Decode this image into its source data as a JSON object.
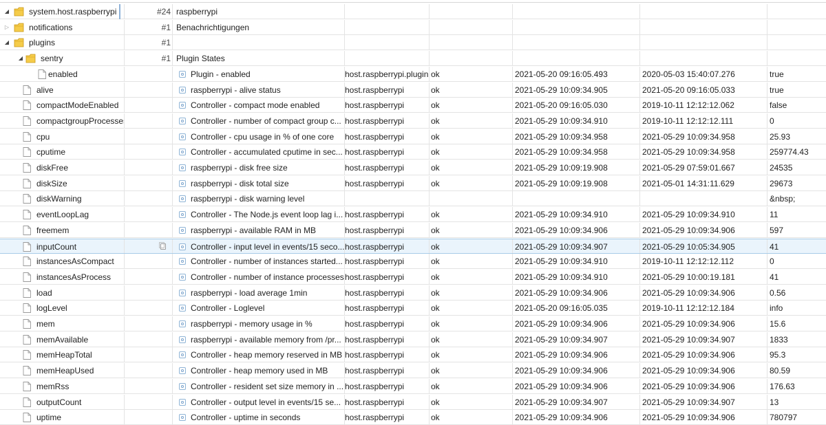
{
  "rows": [
    {
      "kind": "folder",
      "level": 0,
      "open": true,
      "name": "system.host.raspberrypi",
      "count": "#24",
      "desc": "raspberrypi",
      "boxed": true
    },
    {
      "kind": "folder",
      "level": 1,
      "open": false,
      "name": "notifications",
      "count": "#1",
      "desc": "Benachrichtigungen"
    },
    {
      "kind": "folder",
      "level": 1,
      "open": true,
      "name": "plugins",
      "count": "#1",
      "desc": ""
    },
    {
      "kind": "folder",
      "level": 2,
      "open": true,
      "name": "sentry",
      "count": "#1",
      "desc": "Plugin States"
    },
    {
      "kind": "state",
      "level": 3,
      "name": "enabled",
      "desc": "Plugin - enabled",
      "room": "host.raspberrypi.plugin",
      "ack": "ok",
      "ts": "2021-05-20 09:16:05.493",
      "lc": "2020-05-03 15:40:07.276",
      "val": "true"
    },
    {
      "kind": "state",
      "level": 1,
      "name": "alive",
      "desc": "raspberrypi - alive status",
      "room": "host.raspberrypi",
      "ack": "ok",
      "ts": "2021-05-29 10:09:34.905",
      "lc": "2021-05-20 09:16:05.033",
      "val": "true"
    },
    {
      "kind": "state",
      "level": 1,
      "name": "compactModeEnabled",
      "desc": "Controller - compact mode enabled",
      "room": "host.raspberrypi",
      "ack": "ok",
      "ts": "2021-05-20 09:16:05.030",
      "lc": "2019-10-11 12:12:12.062",
      "val": "false"
    },
    {
      "kind": "state",
      "level": 1,
      "name": "compactgroupProcesses",
      "desc": "Controller - number of compact group c...",
      "room": "host.raspberrypi",
      "ack": "ok",
      "ts": "2021-05-29 10:09:34.910",
      "lc": "2019-10-11 12:12:12.111",
      "val": "0"
    },
    {
      "kind": "state",
      "level": 1,
      "name": "cpu",
      "desc": "Controller - cpu usage in % of one core",
      "room": "host.raspberrypi",
      "ack": "ok",
      "ts": "2021-05-29 10:09:34.958",
      "lc": "2021-05-29 10:09:34.958",
      "val": "25.93"
    },
    {
      "kind": "state",
      "level": 1,
      "name": "cputime",
      "desc": "Controller - accumulated cputime in sec...",
      "room": "host.raspberrypi",
      "ack": "ok",
      "ts": "2021-05-29 10:09:34.958",
      "lc": "2021-05-29 10:09:34.958",
      "val": "259774.43"
    },
    {
      "kind": "state",
      "level": 1,
      "name": "diskFree",
      "desc": "raspberrypi - disk free size",
      "room": "host.raspberrypi",
      "ack": "ok",
      "ts": "2021-05-29 10:09:19.908",
      "lc": "2021-05-29 07:59:01.667",
      "val": "24535"
    },
    {
      "kind": "state",
      "level": 1,
      "name": "diskSize",
      "desc": "raspberrypi - disk total size",
      "room": "host.raspberrypi",
      "ack": "ok",
      "ts": "2021-05-29 10:09:19.908",
      "lc": "2021-05-01 14:31:11.629",
      "val": "29673"
    },
    {
      "kind": "state",
      "level": 1,
      "name": "diskWarning",
      "desc": "raspberrypi - disk warning level",
      "room": "",
      "ack": "",
      "ts": "",
      "lc": "",
      "val": "&nbsp;"
    },
    {
      "kind": "state",
      "level": 1,
      "name": "eventLoopLag",
      "desc": "Controller - The Node.js event loop lag i...",
      "room": "host.raspberrypi",
      "ack": "ok",
      "ts": "2021-05-29 10:09:34.910",
      "lc": "2021-05-29 10:09:34.910",
      "val": "11"
    },
    {
      "kind": "state",
      "level": 1,
      "name": "freemem",
      "desc": "raspberrypi - available RAM in MB",
      "room": "host.raspberrypi",
      "ack": "ok",
      "ts": "2021-05-29 10:09:34.906",
      "lc": "2021-05-29 10:09:34.906",
      "val": "597"
    },
    {
      "kind": "state",
      "level": 1,
      "name": "inputCount",
      "desc": "Controller - input level in events/15 seco...",
      "room": "host.raspberrypi",
      "ack": "ok",
      "ts": "2021-05-29 10:09:34.907",
      "lc": "2021-05-29 10:05:34.905",
      "val": "41",
      "selected": true
    },
    {
      "kind": "state",
      "level": 1,
      "name": "instancesAsCompact",
      "desc": "Controller - number of instances started...",
      "room": "host.raspberrypi",
      "ack": "ok",
      "ts": "2021-05-29 10:09:34.910",
      "lc": "2019-10-11 12:12:12.112",
      "val": "0"
    },
    {
      "kind": "state",
      "level": 1,
      "name": "instancesAsProcess",
      "desc": "Controller - number of instance processes",
      "room": "host.raspberrypi",
      "ack": "ok",
      "ts": "2021-05-29 10:09:34.910",
      "lc": "2021-05-29 10:00:19.181",
      "val": "41"
    },
    {
      "kind": "state",
      "level": 1,
      "name": "load",
      "desc": "raspberrypi - load average 1min",
      "room": "host.raspberrypi",
      "ack": "ok",
      "ts": "2021-05-29 10:09:34.906",
      "lc": "2021-05-29 10:09:34.906",
      "val": "0.56"
    },
    {
      "kind": "state",
      "level": 1,
      "name": "logLevel",
      "desc": "Controller - Loglevel",
      "room": "host.raspberrypi",
      "ack": "ok",
      "ts": "2021-05-20 09:16:05.035",
      "lc": "2019-10-11 12:12:12.184",
      "val": "info"
    },
    {
      "kind": "state",
      "level": 1,
      "name": "mem",
      "desc": "raspberrypi - memory usage in %",
      "room": "host.raspberrypi",
      "ack": "ok",
      "ts": "2021-05-29 10:09:34.906",
      "lc": "2021-05-29 10:09:34.906",
      "val": "15.6"
    },
    {
      "kind": "state",
      "level": 1,
      "name": "memAvailable",
      "desc": "raspberrypi - available memory from /pr...",
      "room": "host.raspberrypi",
      "ack": "ok",
      "ts": "2021-05-29 10:09:34.907",
      "lc": "2021-05-29 10:09:34.907",
      "val": "1833"
    },
    {
      "kind": "state",
      "level": 1,
      "name": "memHeapTotal",
      "desc": "Controller - heap memory reserved in MB",
      "room": "host.raspberrypi",
      "ack": "ok",
      "ts": "2021-05-29 10:09:34.906",
      "lc": "2021-05-29 10:09:34.906",
      "val": "95.3"
    },
    {
      "kind": "state",
      "level": 1,
      "name": "memHeapUsed",
      "desc": "Controller - heap memory used in MB",
      "room": "host.raspberrypi",
      "ack": "ok",
      "ts": "2021-05-29 10:09:34.906",
      "lc": "2021-05-29 10:09:34.906",
      "val": "80.59"
    },
    {
      "kind": "state",
      "level": 1,
      "name": "memRss",
      "desc": "Controller - resident set size memory in ...",
      "room": "host.raspberrypi",
      "ack": "ok",
      "ts": "2021-05-29 10:09:34.906",
      "lc": "2021-05-29 10:09:34.906",
      "val": "176.63"
    },
    {
      "kind": "state",
      "level": 1,
      "name": "outputCount",
      "desc": "Controller - output level in events/15 se...",
      "room": "host.raspberrypi",
      "ack": "ok",
      "ts": "2021-05-29 10:09:34.907",
      "lc": "2021-05-29 10:09:34.907",
      "val": "13"
    },
    {
      "kind": "state",
      "level": 1,
      "name": "uptime",
      "desc": "Controller - uptime in seconds",
      "room": "host.raspberrypi",
      "ack": "ok",
      "ts": "2021-05-29 10:09:34.906",
      "lc": "2021-05-29 10:09:34.906",
      "val": "780797"
    }
  ],
  "icons": {
    "folder_icon": "folder-icon",
    "state_icon": "file-icon",
    "desc_icon": "state-role-icon",
    "copy_icon": "copy-icon",
    "expand_icon": "triangle-down-icon",
    "collapsed_icon": "triangle-right-icon"
  },
  "colors": {
    "folder": "#e8b52a",
    "selection_bg": "#eaf4fc",
    "selection_border": "#a8cbe7",
    "grid": "#e3e3e3"
  }
}
